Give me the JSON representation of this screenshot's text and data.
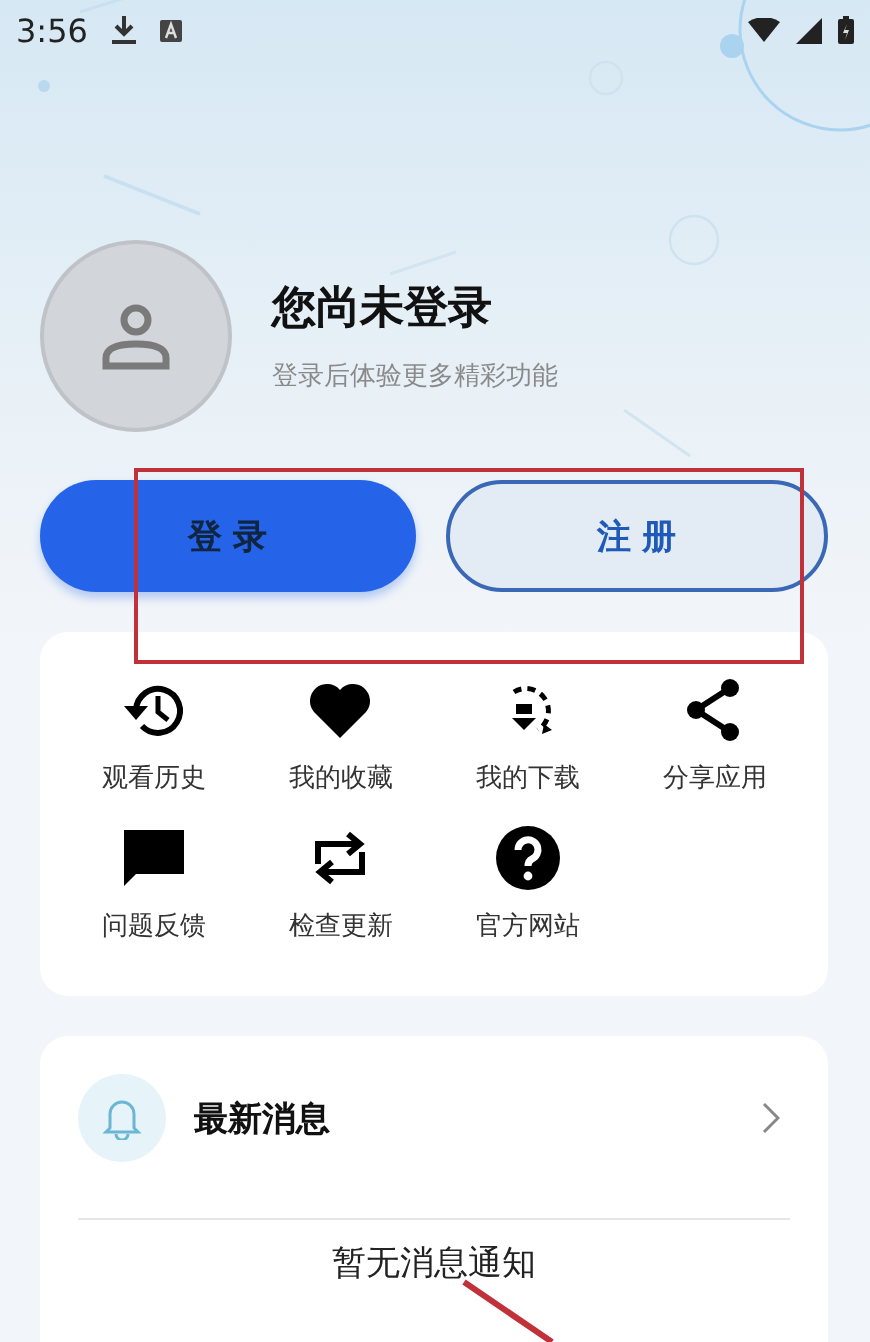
{
  "status_bar": {
    "time": "3:56"
  },
  "profile": {
    "title": "您尚未登录",
    "subtitle": "登录后体验更多精彩功能"
  },
  "buttons": [
    {
      "label": "登 录",
      "kind": "primary"
    },
    {
      "label": "注 册",
      "kind": "outline"
    }
  ],
  "shortcuts": [
    {
      "label": "观看历史"
    },
    {
      "label": "我的收藏"
    },
    {
      "label": "我的下载"
    },
    {
      "label": "分享应用"
    },
    {
      "label": "问题反馈"
    },
    {
      "label": "检查更新"
    },
    {
      "label": "官方网站"
    }
  ],
  "messages": {
    "title": "最新消息",
    "empty_text": "暂无消息通知"
  }
}
